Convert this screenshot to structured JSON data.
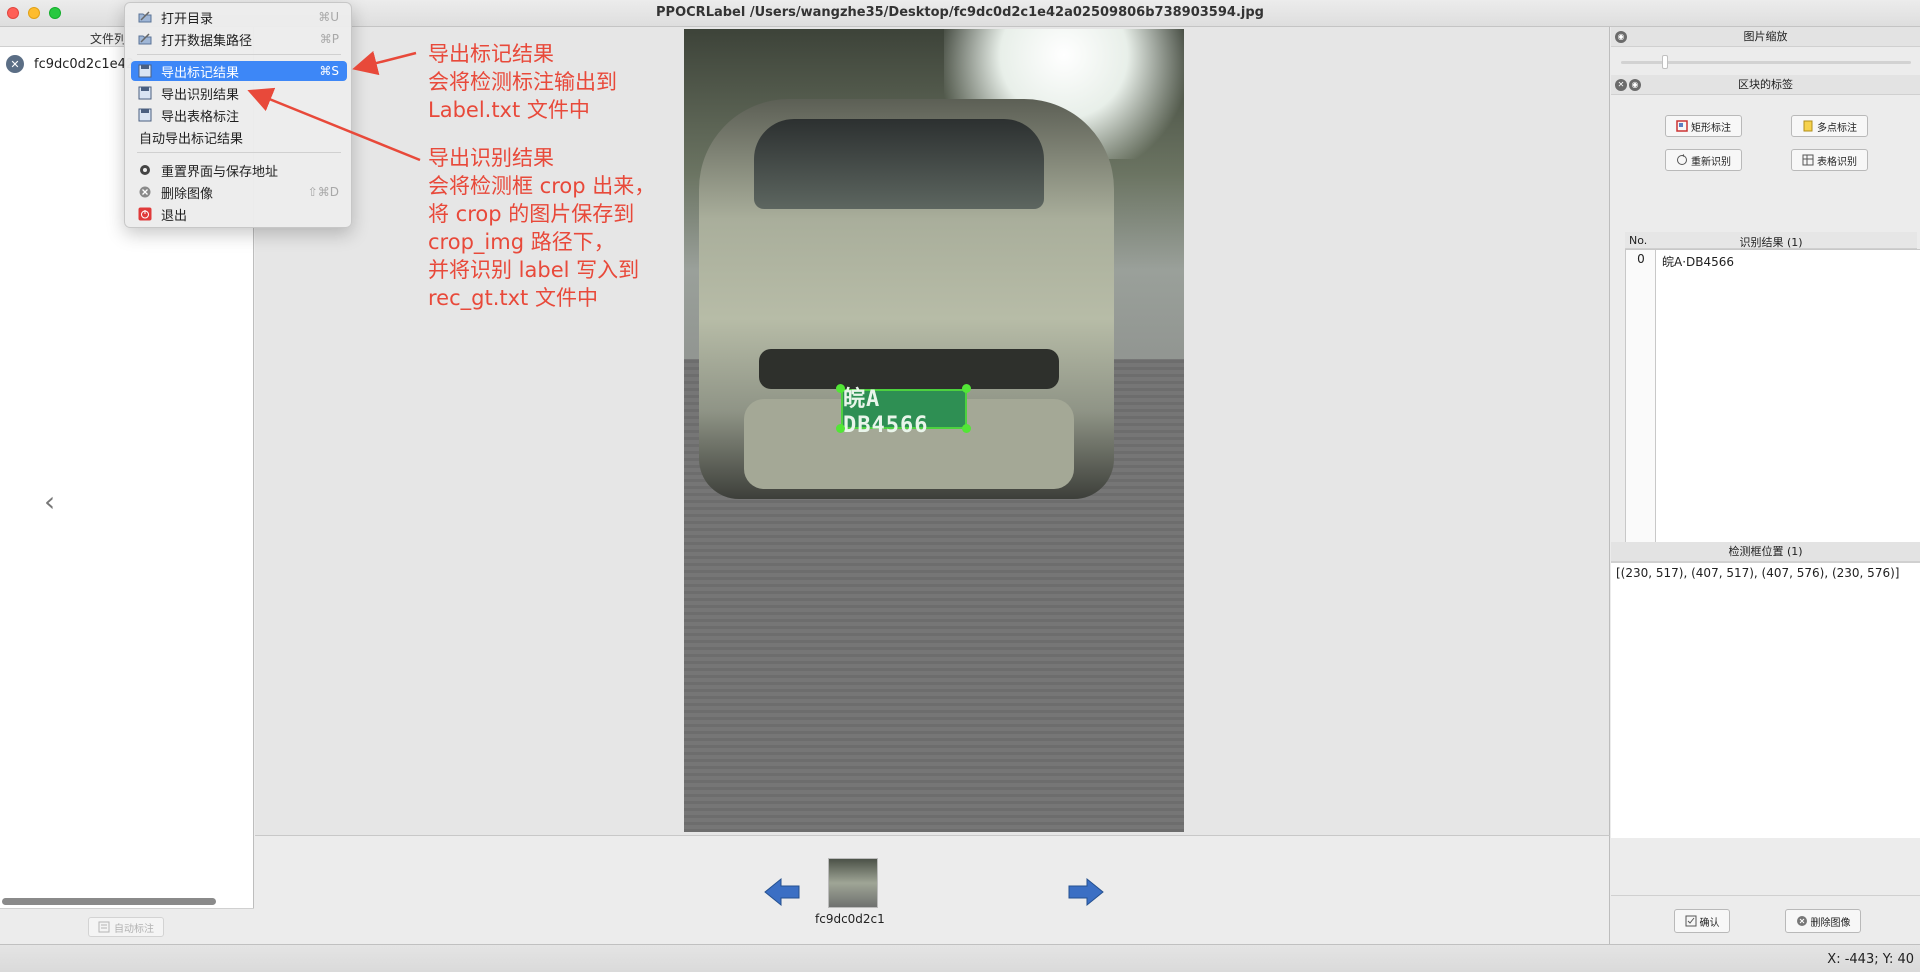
{
  "window": {
    "title": "PPOCRLabel /Users/wangzhe35/Desktop/fc9dc0d2c1e42a02509806b738903594.jpg"
  },
  "file_list": {
    "header": "文件列",
    "items": [
      {
        "name": "fc9dc0d2c1e42",
        "icon": "x-circle-icon"
      }
    ],
    "collapse_icon": "‹",
    "auto_label_button": "自动标注"
  },
  "menu": {
    "items": [
      {
        "label": "打开目录",
        "shortcut": "⌘U",
        "icon": "folder-icon"
      },
      {
        "label": "打开数据集路径",
        "shortcut": "⌘P",
        "icon": "folder-icon"
      },
      {
        "label": "导出标记结果",
        "shortcut": "⌘S",
        "icon": "save-icon",
        "active": true
      },
      {
        "label": "导出识别结果",
        "shortcut": "",
        "icon": "save-icon"
      },
      {
        "label": "导出表格标注",
        "shortcut": "",
        "icon": "save-icon"
      },
      {
        "label": "自动导出标记结果",
        "shortcut": "",
        "icon": ""
      },
      {
        "label": "重置界面与保存地址",
        "shortcut": "",
        "icon": "gear-icon"
      },
      {
        "label": "删除图像",
        "shortcut": "⇧⌘D",
        "icon": "delete-icon"
      },
      {
        "label": "退出",
        "shortcut": "",
        "icon": "power-icon"
      }
    ]
  },
  "annotations": {
    "export_label": [
      "导出标记结果",
      "会将检测标注输出到",
      "Label.txt 文件中"
    ],
    "export_rec": [
      "导出识别结果",
      "会将检测框 crop 出来，",
      "将 crop 的图片保存到",
      "crop_img 路径下，",
      "并将识别 label 写入到",
      "rec_gt.txt 文件中"
    ],
    "color": "#e8493a"
  },
  "canvas": {
    "plate_text": "皖A DB4566"
  },
  "thumbnails": {
    "items": [
      {
        "label": "fc9dc0d2c1"
      }
    ],
    "prev_icon": "arrow-left-icon",
    "next_icon": "arrow-right-icon"
  },
  "right_panel": {
    "zoom_title": "图片缩放",
    "zoom_level": 0.14,
    "label_title": "区块的标签",
    "buttons": {
      "rect": "矩形标注",
      "poly": "多点标注",
      "rerec": "重新识别",
      "table": "表格识别"
    },
    "rec_header": {
      "no": "No.",
      "label": "识别结果 (1)"
    },
    "rec_rows": [
      {
        "idx": "0",
        "text": "皖A·DB4566"
      }
    ],
    "pos_title": "检测框位置 (1)",
    "pos_rows": [
      "[(230, 517), (407, 517), (407, 576), (230, 576)]"
    ],
    "confirm": "确认",
    "delete_image": "删除图像"
  },
  "status": {
    "coords": "X: -443; Y: 40"
  },
  "colors": {
    "menu_highlight": "#3d87f7",
    "box_green": "#4dd13f",
    "arrow_blue": "#3b6fc4"
  }
}
